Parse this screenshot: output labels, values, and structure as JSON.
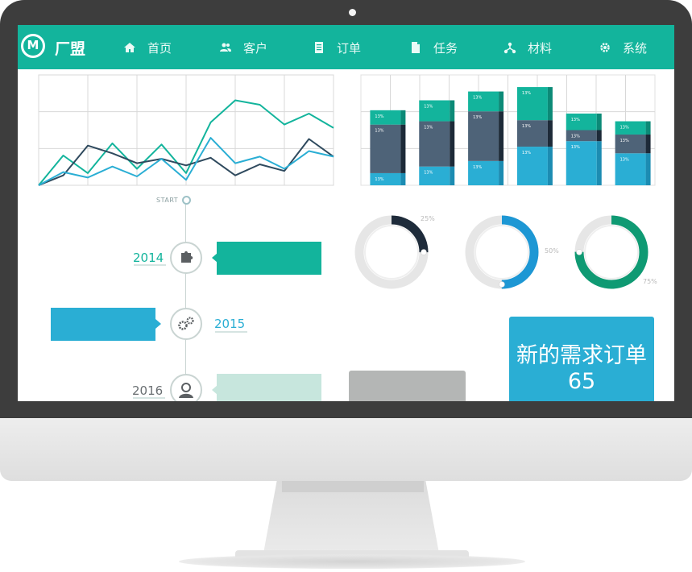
{
  "brand": {
    "logo_letter": "M",
    "name": "厂盟"
  },
  "nav": {
    "items": [
      {
        "label": "首页",
        "icon": "home-icon"
      },
      {
        "label": "客户",
        "icon": "users-icon"
      },
      {
        "label": "订单",
        "icon": "document-icon"
      },
      {
        "label": "任务",
        "icon": "file-icon"
      },
      {
        "label": "材料",
        "icon": "network-icon"
      },
      {
        "label": "系统",
        "icon": "gear-icon"
      }
    ]
  },
  "colors": {
    "accent": "#13b49c",
    "blue": "#2aaed4",
    "navy": "#2f4a5e",
    "slate": "#4e6378",
    "light_teal": "#c7e6dd",
    "gray": "#b4b6b5"
  },
  "chart_data": [
    {
      "type": "line",
      "x": [
        0,
        1,
        2,
        3,
        4,
        5,
        6,
        7,
        8,
        9,
        10,
        11,
        12
      ],
      "series": [
        {
          "values": [
            0,
            27,
            11,
            38,
            15,
            37,
            11,
            57,
            77,
            73,
            55,
            65,
            52
          ]
        },
        {
          "values": [
            0,
            9,
            36,
            29,
            20,
            24,
            18,
            25,
            9,
            19,
            13,
            42,
            26
          ]
        },
        {
          "values": [
            0,
            12,
            7,
            17,
            8,
            24,
            5,
            43,
            20,
            26,
            15,
            31,
            26
          ]
        }
      ]
    },
    {
      "type": "bar",
      "categories": [
        "1",
        "2",
        "3",
        "4",
        "5",
        "6"
      ],
      "series": [
        {
          "values": [
            11,
            17,
            22,
            35,
            40,
            29
          ],
          "labels": [
            "13%",
            "13%",
            "13%",
            "13%",
            "13%",
            "13%"
          ]
        },
        {
          "values": [
            44,
            41,
            45,
            24,
            10,
            17
          ],
          "labels": [
            "13%",
            "13%",
            "13%",
            "13%",
            "13%",
            "13%"
          ]
        },
        {
          "values": [
            13,
            19,
            18,
            30,
            15,
            12
          ],
          "labels": [
            "13%",
            "13%",
            "13%",
            "13%",
            "13%",
            "13%"
          ]
        }
      ]
    }
  ],
  "timeline": {
    "start_label": "START",
    "entries": [
      {
        "year": "2014",
        "side": "left"
      },
      {
        "year": "2015",
        "side": "right"
      },
      {
        "year": "2016",
        "side": "left"
      }
    ]
  },
  "donuts": [
    {
      "label": "25%",
      "value": 0.25,
      "color": "#1e2b3a"
    },
    {
      "label": "50%",
      "value": 0.5,
      "color": "#1d97d4"
    },
    {
      "label": "75%",
      "value": 0.75,
      "color": "#0f9a73"
    }
  ],
  "order_card": {
    "title": "新的需求订单",
    "count": "65"
  }
}
